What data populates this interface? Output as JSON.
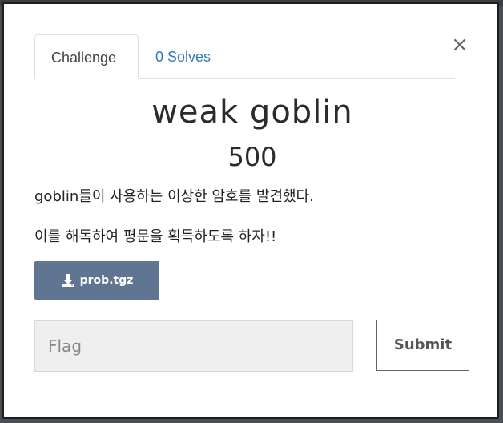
{
  "modal": {
    "close_symbol": "×",
    "tabs": [
      {
        "label": "Challenge",
        "active": true
      },
      {
        "label": "0 Solves",
        "active": false
      }
    ],
    "title": "weak goblin",
    "points": "500",
    "description_lines": [
      "goblin들이 사용하는 이상한 암호를 발견했다.",
      "이를 해독하여 평문을 획득하도록 하자!!"
    ],
    "download": {
      "label": "prob.tgz",
      "icon": "download-icon"
    },
    "flag": {
      "placeholder": "Flag",
      "value": ""
    },
    "submit_label": "Submit"
  },
  "colors": {
    "link": "#337ab7",
    "download_bg": "#5f7591",
    "input_bg": "#efefef"
  }
}
